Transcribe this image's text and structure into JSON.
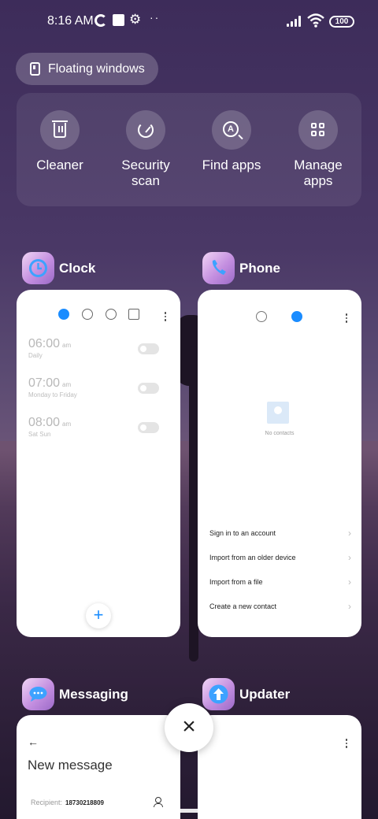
{
  "status_bar": {
    "time": "8:16 AM",
    "battery": "100",
    "icons": [
      "data-saver-icon",
      "square-icon",
      "gear-icon",
      "more-dots-icon",
      "signal-icon",
      "wifi-icon",
      "battery-icon"
    ]
  },
  "floating_windows": {
    "label": "Floating windows"
  },
  "quick_actions": [
    {
      "label": "Cleaner",
      "icon": "trash-icon"
    },
    {
      "label": "Security\nscan",
      "line1": "Security",
      "line2": "scan",
      "icon": "scan-icon"
    },
    {
      "label": "Find apps",
      "icon": "find-apps-icon"
    },
    {
      "label": "Manage\napps",
      "line1": "Manage",
      "line2": "apps",
      "icon": "grid-icon"
    }
  ],
  "apps": {
    "clock": {
      "name": "Clock",
      "alarms": [
        {
          "time": "06:00",
          "ampm": "am",
          "repeat": "Daily"
        },
        {
          "time": "07:00",
          "ampm": "am",
          "repeat": "Monday to Friday"
        },
        {
          "time": "08:00",
          "ampm": "am",
          "repeat": "Sat Sun"
        }
      ],
      "fab": "+"
    },
    "phone": {
      "name": "Phone",
      "empty_text": "No contacts",
      "links": [
        "Sign in to an account",
        "Import from an older device",
        "Import from a file",
        "Create a new contact"
      ]
    },
    "messaging": {
      "name": "Messaging",
      "title": "New message",
      "recipient_label": "Recipient:",
      "recipient_value": "18730218809"
    },
    "updater": {
      "name": "Updater"
    }
  },
  "close_button": "×",
  "colors": {
    "accent": "#1a8cff",
    "card_bg": "#ffffff"
  }
}
